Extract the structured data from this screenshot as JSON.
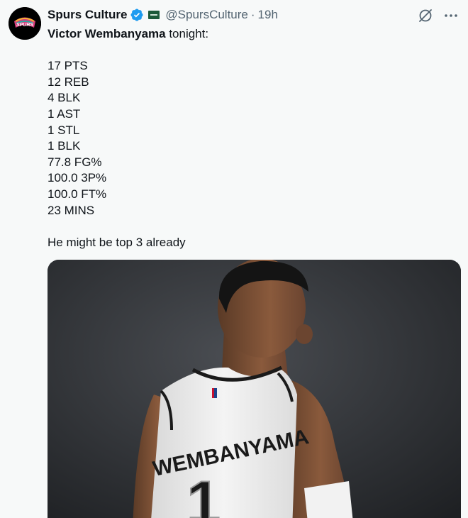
{
  "tweet": {
    "display_name": "Spurs Culture",
    "handle": "@SpursCulture",
    "separator": "·",
    "time": "19h",
    "avatar_text": "SPURS",
    "lines": [
      {
        "bold": "Victor Wembanyama",
        "text": " tonight:"
      },
      {
        "bold": "",
        "text": ""
      },
      {
        "bold": "",
        "text": "17 PTS"
      },
      {
        "bold": "",
        "text": "12 REB"
      },
      {
        "bold": "",
        "text": "4 BLK"
      },
      {
        "bold": "",
        "text": "1 AST"
      },
      {
        "bold": "",
        "text": "1 STL"
      },
      {
        "bold": "",
        "text": "1 BLK"
      },
      {
        "bold": "",
        "text": "77.8 FG%"
      },
      {
        "bold": "",
        "text": "100.0 3P%"
      },
      {
        "bold": "",
        "text": "100.0 FT%"
      },
      {
        "bold": "",
        "text": "23 MINS"
      },
      {
        "bold": "",
        "text": ""
      },
      {
        "bold": "",
        "text": "He might be top 3 already"
      }
    ],
    "media": {
      "jersey_name": "WEMBANYAMA",
      "jersey_number": "1"
    }
  },
  "icons": {
    "verified": "verified-badge-icon",
    "affiliate": "affiliate-badge-icon",
    "grok": "grok-icon",
    "more": "more-icon"
  },
  "colors": {
    "background": "#f7f9f9",
    "text": "#0f1419",
    "secondary": "#536471",
    "verified_blue": "#1d9bf0"
  }
}
